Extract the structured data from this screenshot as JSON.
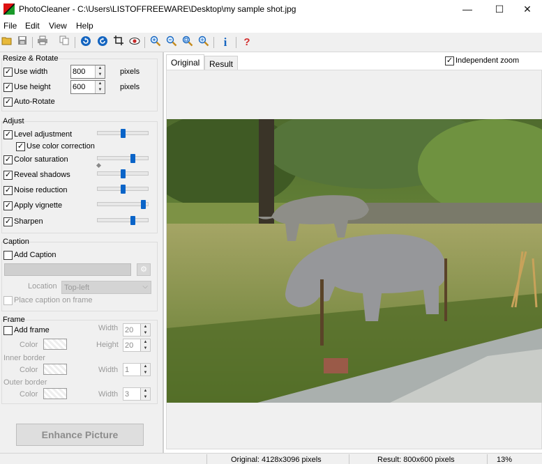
{
  "window": {
    "title": "PhotoCleaner - C:\\Users\\LISTOFFREEWARE\\Desktop\\my sample shot.jpg",
    "minimize": "—",
    "maximize": "☐",
    "close": "✕"
  },
  "menu": [
    "File",
    "Edit",
    "View",
    "Help"
  ],
  "resize": {
    "title": "Resize & Rotate",
    "use_width_label": "Use width",
    "width_value": "800",
    "width_unit": "pixels",
    "use_height_label": "Use height",
    "height_value": "600",
    "height_unit": "pixels",
    "auto_rotate_label": "Auto-Rotate"
  },
  "adjust": {
    "title": "Adjust",
    "items": [
      {
        "label": "Level adjustment",
        "checked": true,
        "level": 0.5
      },
      {
        "label": "Use color correction",
        "checked": true
      },
      {
        "label": "Color saturation",
        "checked": true,
        "level": 0.72
      },
      {
        "label": "Reveal shadows",
        "checked": true,
        "level": 0.5
      },
      {
        "label": "Noise reduction",
        "checked": true,
        "level": 0.5
      },
      {
        "label": "Apply vignette",
        "checked": true,
        "level": 0.95
      },
      {
        "label": "Sharpen",
        "checked": true,
        "level": 0.72
      }
    ]
  },
  "caption": {
    "title": "Caption",
    "add_label": "Add Caption",
    "location_label": "Location",
    "location_value": "Top-left",
    "place_on_frame_label": "Place caption on frame"
  },
  "frame": {
    "title": "Frame",
    "add_label": "Add frame",
    "color_label": "Color",
    "width_label": "Width",
    "width_value": "20",
    "height_label": "Height",
    "height_value": "20",
    "inner_border_title": "Inner border",
    "inner_color_label": "Color",
    "inner_width_label": "Width",
    "inner_width_value": "1",
    "outer_border_title": "Outer border",
    "outer_color_label": "Color",
    "outer_width_label": "Width",
    "outer_width_value": "3"
  },
  "enhance_button": "Enhance Picture",
  "tabs": {
    "original": "Original",
    "result": "Result"
  },
  "independent_zoom_label": "Independent zoom",
  "status": {
    "original": "Original: 4128x3096 pixels",
    "result": "Result: 800x600 pixels",
    "zoom": "13%"
  },
  "icons": [
    "open-icon",
    "save-icon",
    "print-icon",
    "copy-icon",
    "rotate-left-icon",
    "rotate-right-icon",
    "crop-icon",
    "redeye-icon",
    "zoom-in-icon",
    "zoom-out-icon",
    "zoom-fit-icon",
    "zoom-actual-icon",
    "info-icon",
    "help-icon"
  ]
}
